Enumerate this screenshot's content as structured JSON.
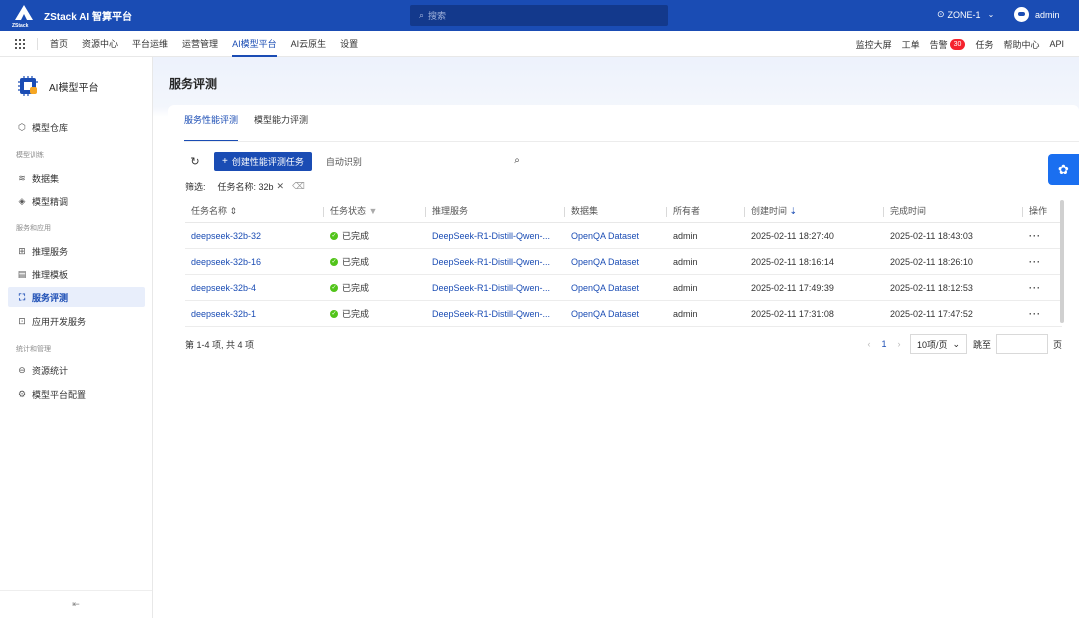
{
  "header": {
    "logo_sub": "ZStack",
    "app_title": "ZStack AI 智算平台",
    "search_placeholder": "搜索",
    "zone": "ZONE-1",
    "user": "admin"
  },
  "nav": {
    "items": [
      "首页",
      "资源中心",
      "平台运维",
      "运营管理",
      "AI模型平台",
      "AI云原生",
      "设置"
    ],
    "active_index": 4,
    "right": {
      "monitor": "监控大屏",
      "ticket": "工单",
      "alert": "告警",
      "alert_count": "30",
      "task": "任务",
      "help": "帮助中心",
      "api": "API"
    }
  },
  "sidebar": {
    "title": "AI模型平台",
    "item_model_repo": "模型仓库",
    "group_training": "模型训练",
    "item_dataset": "数据集",
    "item_finetune": "模型精调",
    "group_app": "服务和应用",
    "item_inference": "推理服务",
    "item_template": "推理模板",
    "item_eval": "服务评测",
    "item_appdev": "应用开发服务",
    "group_stats": "统计和管理",
    "item_resource": "资源统计",
    "item_config": "模型平台配置"
  },
  "main": {
    "page_title": "服务评测",
    "tabs": [
      "服务性能评测",
      "模型能力评测"
    ],
    "active_tab": 0,
    "create_button": "创建性能评测任务",
    "filter_placeholder": "自动识别",
    "filter_label": "筛选:",
    "filter_tag": "任务名称: 32b"
  },
  "table": {
    "columns": [
      "任务名称",
      "任务状态",
      "推理服务",
      "数据集",
      "所有者",
      "创建时间",
      "完成时间",
      "操作"
    ],
    "rows": [
      {
        "name": "deepseek-32b-32",
        "status": "已完成",
        "service": "DeepSeek-R1-Distill-Qwen-...",
        "dataset": "OpenQA Dataset",
        "owner": "admin",
        "created": "2025-02-11 18:27:40",
        "finished": "2025-02-11 18:43:03"
      },
      {
        "name": "deepseek-32b-16",
        "status": "已完成",
        "service": "DeepSeek-R1-Distill-Qwen-...",
        "dataset": "OpenQA Dataset",
        "owner": "admin",
        "created": "2025-02-11 18:16:14",
        "finished": "2025-02-11 18:26:10"
      },
      {
        "name": "deepseek-32b-4",
        "status": "已完成",
        "service": "DeepSeek-R1-Distill-Qwen-...",
        "dataset": "OpenQA Dataset",
        "owner": "admin",
        "created": "2025-02-11 17:49:39",
        "finished": "2025-02-11 18:12:53"
      },
      {
        "name": "deepseek-32b-1",
        "status": "已完成",
        "service": "DeepSeek-R1-Distill-Qwen-...",
        "dataset": "OpenQA Dataset",
        "owner": "admin",
        "created": "2025-02-11 17:31:08",
        "finished": "2025-02-11 17:47:52"
      }
    ]
  },
  "pagination": {
    "summary": "第 1-4 项, 共 4 项",
    "current": "1",
    "page_size": "10项/页",
    "jump_label": "跳至",
    "page_label": "页"
  },
  "icons": {
    "accent": "#1a4cb4",
    "success": "#52c41a"
  }
}
